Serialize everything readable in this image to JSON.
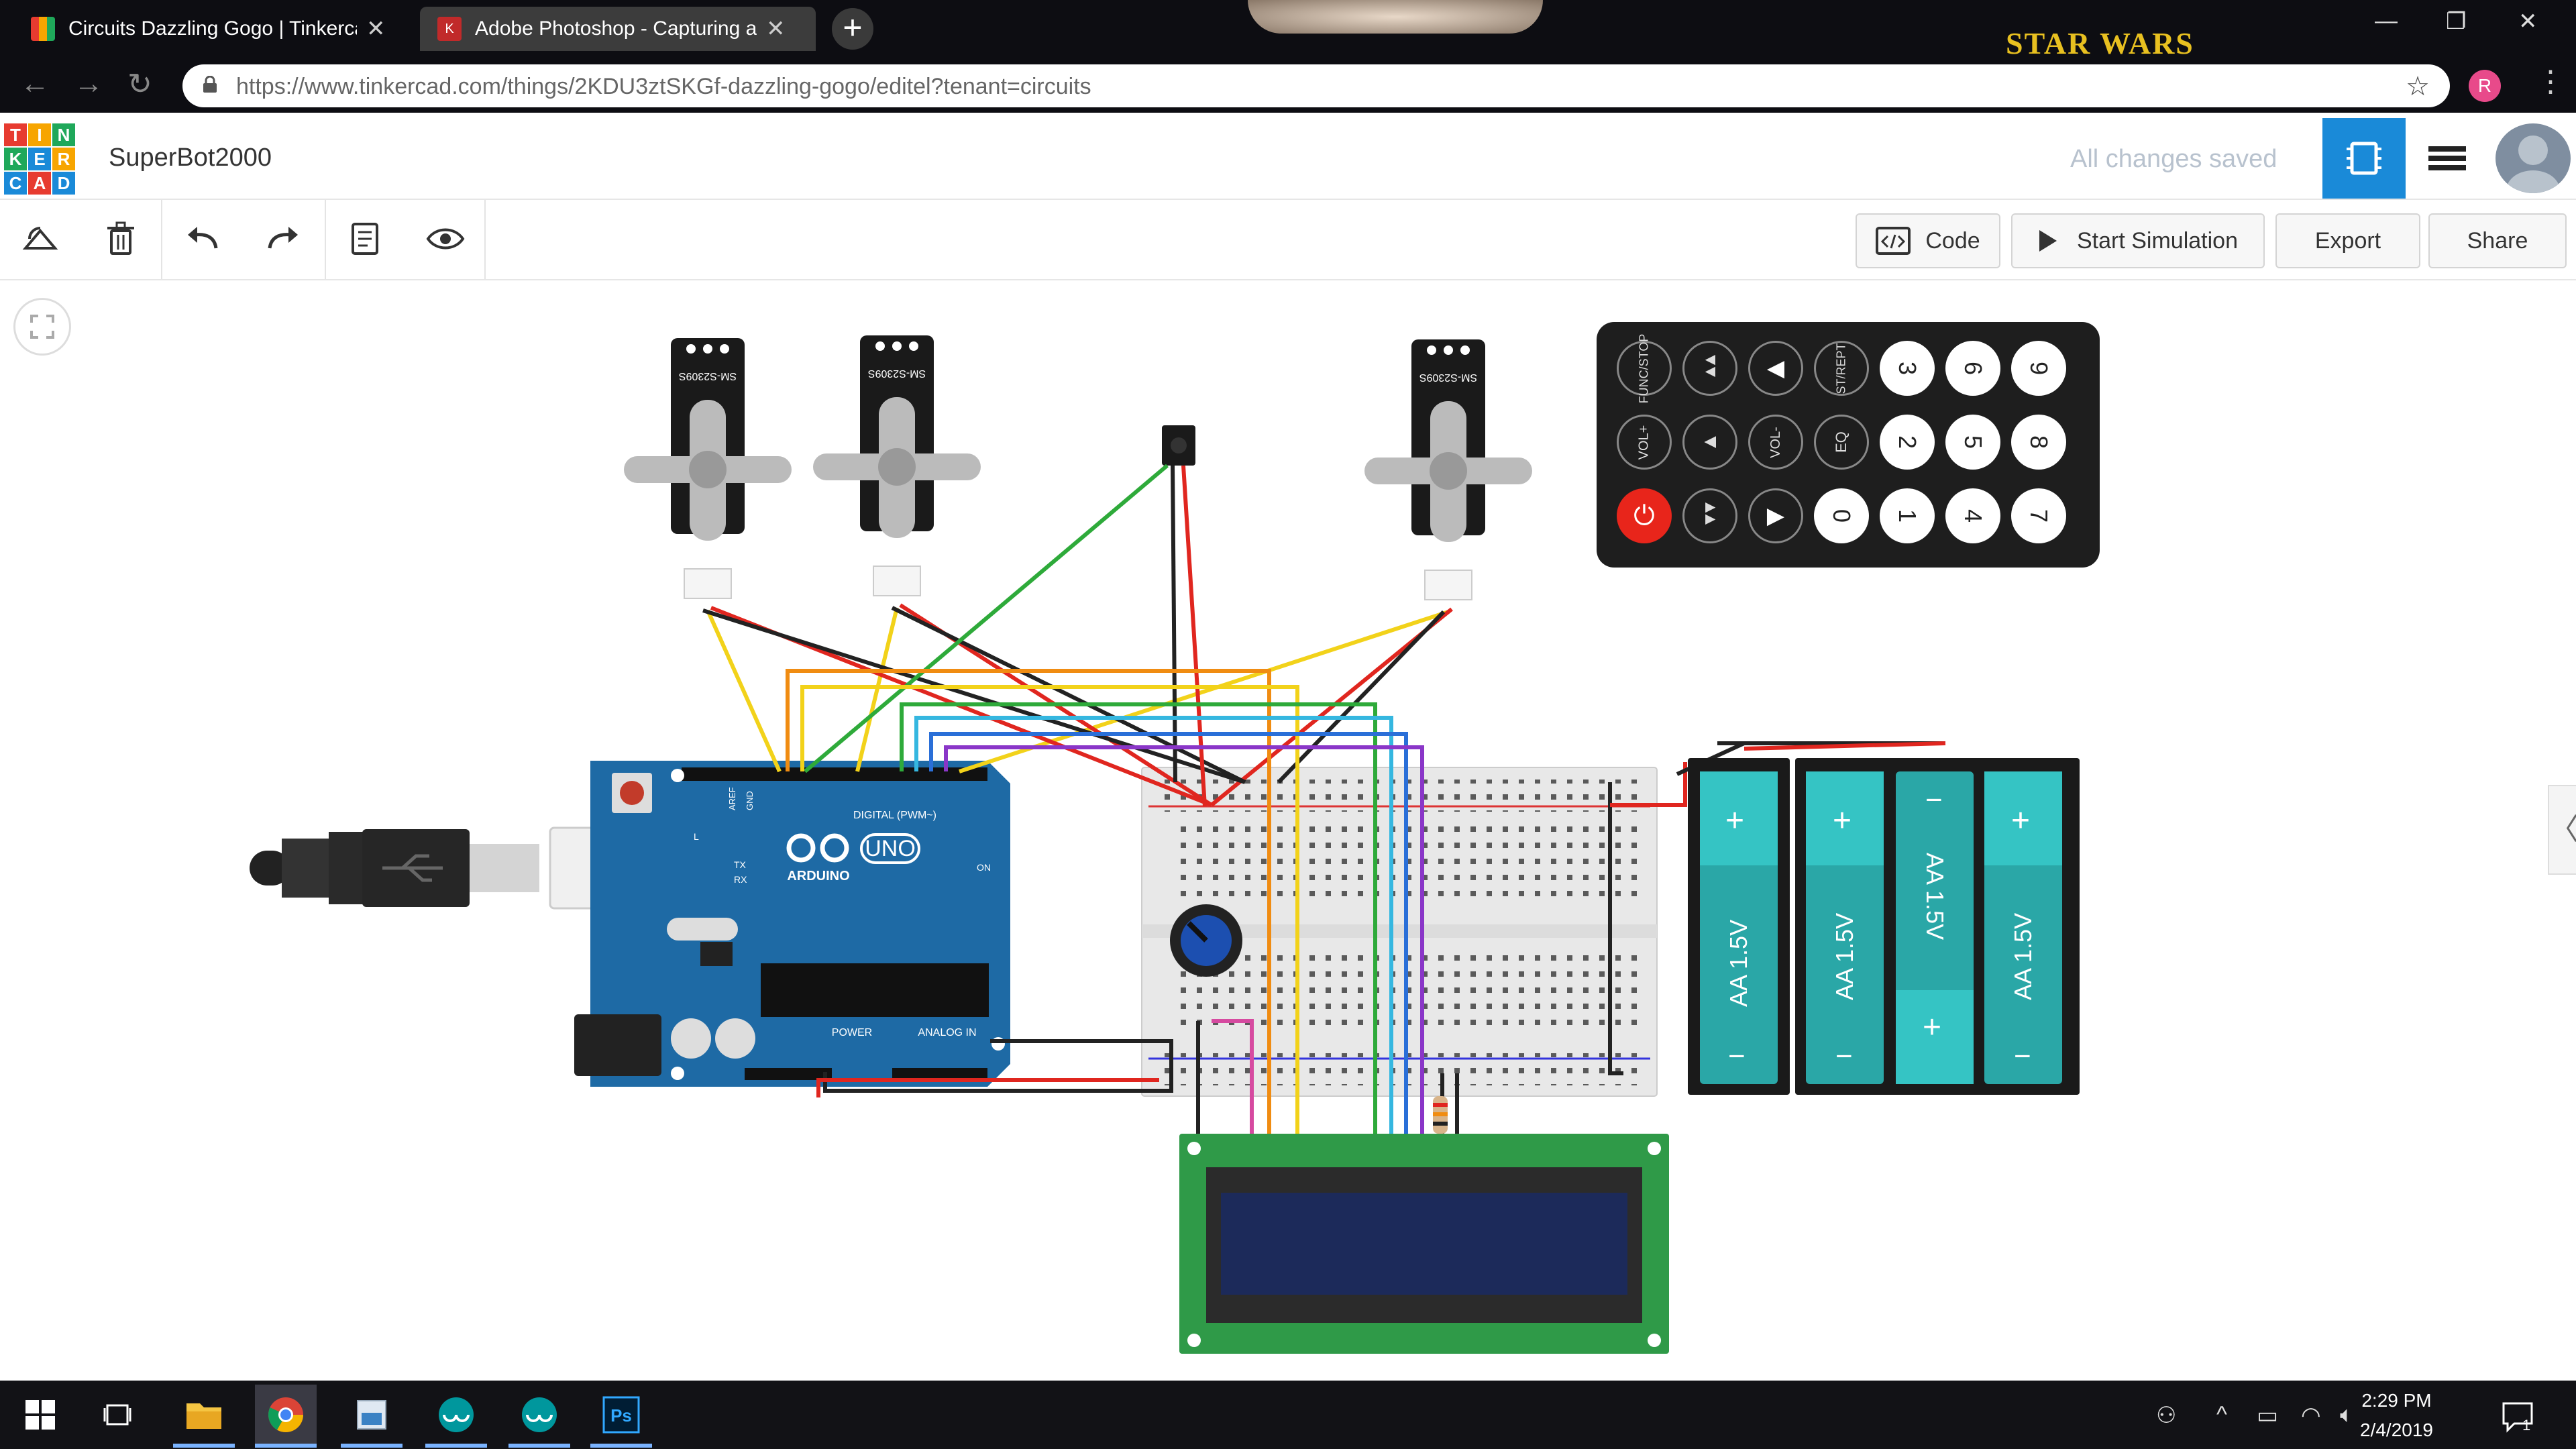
{
  "browser": {
    "tabs": [
      {
        "title": "Circuits Dazzling Gogo | Tinkercad",
        "active": false
      },
      {
        "title": "Adobe Photoshop - Capturing an",
        "active": true
      }
    ],
    "url": "https://www.tinkercad.com/things/2KDU3ztSKGf-dazzling-gogo/editel?tenant=circuits",
    "profile_initial": "R",
    "wallpaper_text": "STAR WARS"
  },
  "app": {
    "logo_letters": [
      "T",
      "I",
      "N",
      "K",
      "E",
      "R",
      "C",
      "A",
      "D"
    ],
    "project_name": "SuperBot2000",
    "save_status": "All changes saved"
  },
  "toolbar": {
    "code_label": "Code",
    "simulate_label": "Start Simulation",
    "export_label": "Export",
    "share_label": "Share"
  },
  "circuit": {
    "servo_label": "SM-S2309S",
    "remote_buttons": [
      [
        "FUNC/STOP",
        "▲▲",
        "◀",
        "ST/REPT",
        "3",
        "6",
        "9"
      ],
      [
        "VOL+",
        "▲",
        "VOL-",
        "EQ",
        "2",
        "5",
        "8"
      ],
      [
        "⏻",
        "▼▼",
        "▶",
        "0",
        "1",
        "4",
        "7"
      ]
    ],
    "batteries": [
      "AA 1.5V",
      "AA 1.5V",
      "AA 1.5V",
      "AA 1.5V"
    ],
    "battery_plus": "+",
    "battery_minus": "−",
    "arduino": {
      "brand": "ARDUINO",
      "model": "UNO",
      "digital_label": "DIGITAL (PWM~)",
      "power_label": "POWER",
      "analog_label": "ANALOG IN",
      "on_label": "ON",
      "tx_label": "TX",
      "rx_label": "RX",
      "l_label": "L",
      "aref_label": "AREF",
      "gnd_label": "GND"
    }
  },
  "taskbar": {
    "time": "2:29 PM",
    "date": "2/4/2019",
    "notification_count": "1"
  },
  "colors": {
    "accent": "#1a8ad8",
    "wire_red": "#e0261f",
    "wire_black": "#222222",
    "wire_yellow": "#f2d21a",
    "wire_orange": "#f08c12",
    "wire_green": "#2eaa3a",
    "wire_cyan": "#35b7e0",
    "wire_blue": "#2a6fd8",
    "wire_purple": "#8a36c8",
    "arduino_blue": "#1e6aa5",
    "battery_teal": "#2ec1c1",
    "lcd_green": "#2f9a48"
  }
}
